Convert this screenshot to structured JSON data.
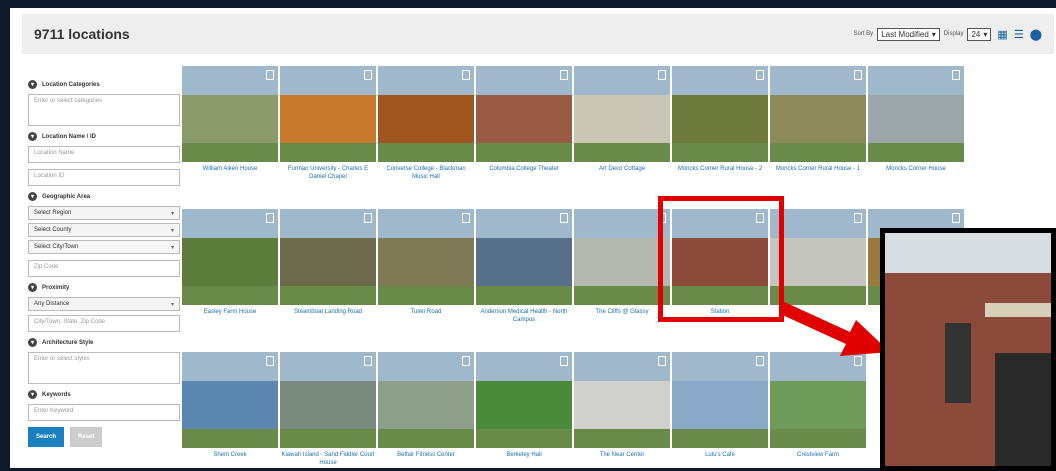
{
  "header": {
    "count": "9711 locations",
    "sort_label": "Sort By",
    "sort_value": "Last Modified",
    "display_label": "Display",
    "display_value": "24"
  },
  "sidebar": {
    "categories": {
      "title": "Location Categories",
      "placeholder": "Enter or select categories"
    },
    "name_id": {
      "title": "Location Name / ID",
      "name_placeholder": "Location Name",
      "id_placeholder": "Location ID"
    },
    "geo": {
      "title": "Geographic Area",
      "region": "Select Region",
      "county": "Select County",
      "city": "Select City/Town",
      "zip": "Zip Code"
    },
    "proximity": {
      "title": "Proximity",
      "distance": "Any Distance",
      "place_placeholder": "City/Town, State, Zip Code"
    },
    "arch": {
      "title": "Architecture Style",
      "placeholder": "Enter or select styles"
    },
    "keywords": {
      "title": "Keywords",
      "placeholder": "Enter Keyword"
    },
    "search_label": "Search",
    "reset_label": "Reset"
  },
  "cards": [
    {
      "name": "William Aiken House",
      "color": "#8b9a6a"
    },
    {
      "name": "Furman University - Charles E Daniel Chapel",
      "color": "#c7792c"
    },
    {
      "name": "Converse College - Blackman Music Hall",
      "color": "#a0561f"
    },
    {
      "name": "Columbia College Theater",
      "color": "#9a5b45"
    },
    {
      "name": "Art Deco Cottage",
      "color": "#c9c6b6"
    },
    {
      "name": "Moncks Corner Rural House - 2",
      "color": "#6d7a3c"
    },
    {
      "name": "Moncks Corner Rural House - 1",
      "color": "#8a8a5a"
    },
    {
      "name": "Moncks Corner House",
      "color": "#9aa6a8"
    },
    {
      "name": "Easley Farm House",
      "color": "#5b7c3a"
    },
    {
      "name": "Steamboat Landing Road",
      "color": "#6b6a4a"
    },
    {
      "name": "Tulen Road",
      "color": "#7d7a55"
    },
    {
      "name": "Anderson Medical Health - North Campus",
      "color": "#58718a"
    },
    {
      "name": "The Cliffs @ Glassy",
      "color": "#b5b8b0"
    },
    {
      "name": "Station",
      "color": "#8b4a3a"
    },
    {
      "name": "",
      "color": "#c5c5c0"
    },
    {
      "name": "",
      "color": "#9a7a40"
    },
    {
      "name": "Shem Creek",
      "color": "#5a86b0"
    },
    {
      "name": "Kiawah Island - Sand Fiddler Court House",
      "color": "#7a8a7e"
    },
    {
      "name": "Belfair Fitness Center",
      "color": "#8fa08a"
    },
    {
      "name": "Berkeley Hall",
      "color": "#4a8a3a"
    },
    {
      "name": "The Near Center",
      "color": "#d0d0cc"
    },
    {
      "name": "Lulu's Cafe",
      "color": "#8aa8c8"
    },
    {
      "name": "Crestview Farm",
      "color": "#6e9a5a"
    }
  ],
  "colors": {
    "highlight": "#e00000",
    "link": "#1a70b0",
    "search_btn": "#1a80c0"
  }
}
